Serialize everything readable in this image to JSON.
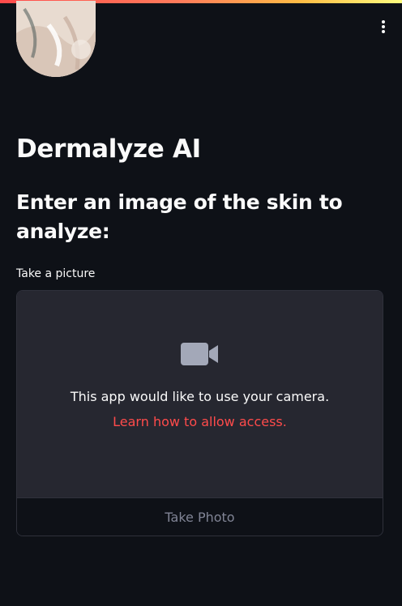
{
  "app": {
    "title": "Dermalyze AI",
    "subtitle": "Enter an image of the skin to analyze:"
  },
  "header": {
    "expand_icon": "chevron-right-icon",
    "menu_icon": "vertical-dots-icon"
  },
  "camera_input": {
    "label": "Take a picture",
    "permission_text": "This app would like to use your camera.",
    "permission_link": "Learn how to allow access.",
    "button_label": "Take Photo",
    "icon": "video-camera-icon"
  },
  "colors": {
    "background": "#0e1117",
    "panel": "#262730",
    "accent": "#ff4b4b",
    "muted_text": "#808495"
  }
}
